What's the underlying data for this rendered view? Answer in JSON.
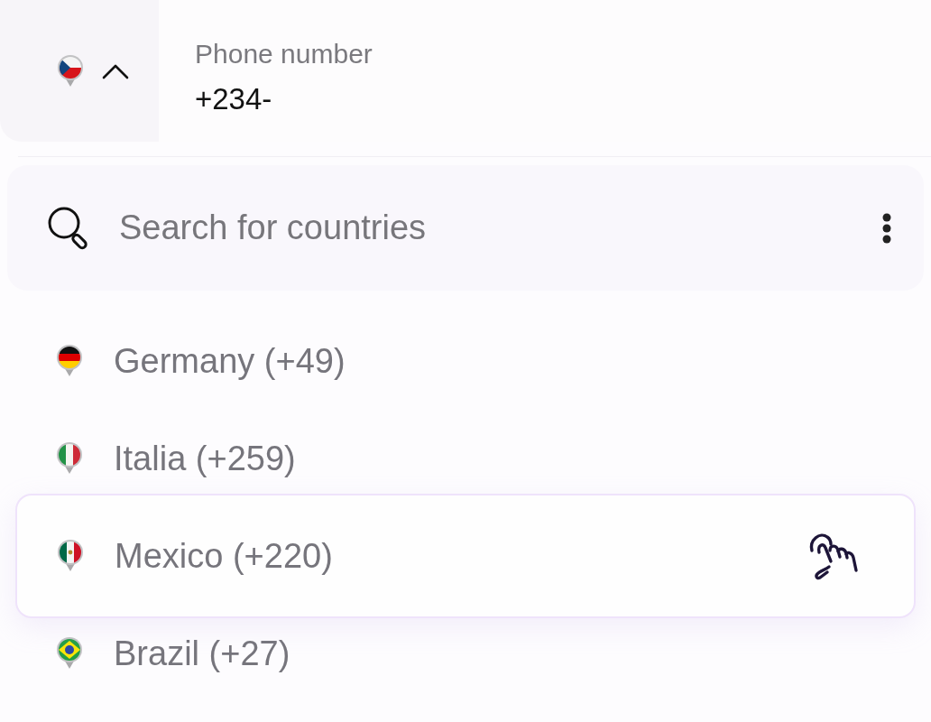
{
  "phone_field": {
    "country_picker": {
      "kind": "czech",
      "expanded": true
    },
    "label": "Phone number",
    "value": "+234-"
  },
  "search": {
    "placeholder": "Search for countries"
  },
  "countries": [
    {
      "kind": "germany",
      "label": "Germany (+49)",
      "selected": false
    },
    {
      "kind": "italy",
      "label": "Italia (+259)",
      "selected": false
    },
    {
      "kind": "mexico",
      "label": "Mexico (+220)",
      "selected": true
    },
    {
      "kind": "brazil",
      "label": "Brazil (+27)",
      "selected": false
    }
  ]
}
